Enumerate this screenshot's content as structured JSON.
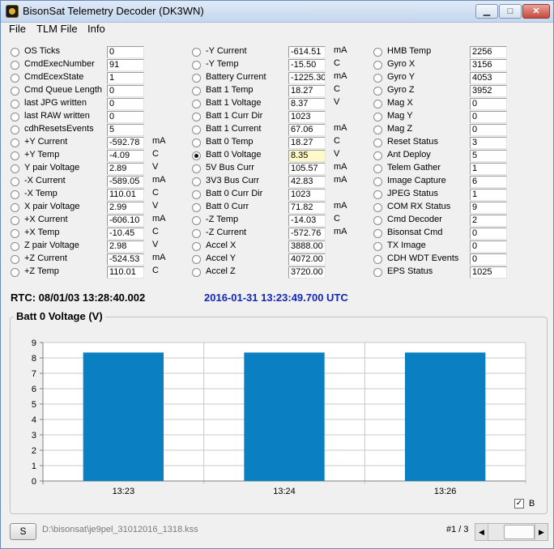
{
  "window": {
    "title": "BisonSat Telemetry Decoder (DK3WN)"
  },
  "menu": [
    "File",
    "TLM File",
    "Info"
  ],
  "columns": [
    [
      {
        "label": "OS Ticks",
        "value": "0",
        "unit": ""
      },
      {
        "label": "CmdExecNumber",
        "value": "91",
        "unit": ""
      },
      {
        "label": "CmdEcexState",
        "value": "1",
        "unit": ""
      },
      {
        "label": "Cmd Queue Length",
        "value": "0",
        "unit": ""
      },
      {
        "label": "last JPG written",
        "value": "0",
        "unit": ""
      },
      {
        "label": "last RAW written",
        "value": "0",
        "unit": ""
      },
      {
        "label": "cdhResetsEvents",
        "value": "5",
        "unit": ""
      },
      {
        "label": "+Y Current",
        "value": "-592.78",
        "unit": "mA"
      },
      {
        "label": "+Y Temp",
        "value": "-4.09",
        "unit": "C"
      },
      {
        "label": "Y pair Voltage",
        "value": "2.89",
        "unit": "V"
      },
      {
        "label": "-X Current",
        "value": "-589.05",
        "unit": "mA"
      },
      {
        "label": "-X Temp",
        "value": "110.01",
        "unit": "C"
      },
      {
        "label": "X pair Voltage",
        "value": "2.99",
        "unit": "V"
      },
      {
        "label": "+X Current",
        "value": "-606.10",
        "unit": "mA"
      },
      {
        "label": "+X Temp",
        "value": "-10.45",
        "unit": "C"
      },
      {
        "label": "Z pair Voltage",
        "value": "2.98",
        "unit": "V"
      },
      {
        "label": "+Z Current",
        "value": "-524.53",
        "unit": "mA"
      },
      {
        "label": "+Z Temp",
        "value": "110.01",
        "unit": "C"
      }
    ],
    [
      {
        "label": "-Y Current",
        "value": "-614.51",
        "unit": "mA"
      },
      {
        "label": "-Y Temp",
        "value": "-15.50",
        "unit": "C"
      },
      {
        "label": "Battery Current",
        "value": "-1225.30",
        "unit": "mA"
      },
      {
        "label": "Batt 1 Temp",
        "value": "18.27",
        "unit": "C"
      },
      {
        "label": "Batt 1 Voltage",
        "value": "8.37",
        "unit": "V"
      },
      {
        "label": "Batt 1 Curr Dir",
        "value": "1023",
        "unit": ""
      },
      {
        "label": "Batt 1 Current",
        "value": "67.06",
        "unit": "mA"
      },
      {
        "label": "Batt 0 Temp",
        "value": "18.27",
        "unit": "C"
      },
      {
        "label": "Batt 0 Voltage",
        "value": "8.35",
        "unit": "V",
        "selected": true
      },
      {
        "label": "5V Bus Curr",
        "value": "105.57",
        "unit": "mA"
      },
      {
        "label": "3V3 Bus Curr",
        "value": "42.83",
        "unit": "mA"
      },
      {
        "label": "Batt 0 Curr Dir",
        "value": "1023",
        "unit": ""
      },
      {
        "label": "Batt 0 Curr",
        "value": "71.82",
        "unit": "mA"
      },
      {
        "label": "-Z Temp",
        "value": "-14.03",
        "unit": "C"
      },
      {
        "label": "-Z Current",
        "value": "-572.76",
        "unit": "mA"
      },
      {
        "label": "Accel X",
        "value": "3888.00",
        "unit": ""
      },
      {
        "label": "Accel Y",
        "value": "4072.00",
        "unit": ""
      },
      {
        "label": "Accel Z",
        "value": "3720.00",
        "unit": ""
      }
    ],
    [
      {
        "label": "HMB Temp",
        "value": "2256",
        "unit": ""
      },
      {
        "label": "Gyro X",
        "value": "3156",
        "unit": ""
      },
      {
        "label": "Gyro Y",
        "value": "4053",
        "unit": ""
      },
      {
        "label": "Gyro Z",
        "value": "3952",
        "unit": ""
      },
      {
        "label": "Mag X",
        "value": "0",
        "unit": ""
      },
      {
        "label": "Mag Y",
        "value": "0",
        "unit": ""
      },
      {
        "label": "Mag Z",
        "value": "0",
        "unit": ""
      },
      {
        "label": "Reset Status",
        "value": "3",
        "unit": ""
      },
      {
        "label": "Ant Deploy",
        "value": "5",
        "unit": ""
      },
      {
        "label": "Telem Gather",
        "value": "1",
        "unit": ""
      },
      {
        "label": "Image Capture",
        "value": "6",
        "unit": ""
      },
      {
        "label": "JPEG Status",
        "value": "1",
        "unit": ""
      },
      {
        "label": "COM RX Status",
        "value": "9",
        "unit": ""
      },
      {
        "label": "Cmd Decoder",
        "value": "2",
        "unit": ""
      },
      {
        "label": "Bisonsat Cmd",
        "value": "0",
        "unit": ""
      },
      {
        "label": "TX Image",
        "value": "0",
        "unit": ""
      },
      {
        "label": "CDH WDT Events",
        "value": "0",
        "unit": ""
      },
      {
        "label": "EPS Status",
        "value": "1025",
        "unit": ""
      }
    ]
  ],
  "rtc": "RTC: 08/01/03 13:28:40.002",
  "utc": "2016-01-31 13:23:49.700 UTC",
  "chart_data": {
    "type": "bar",
    "title": "Batt 0 Voltage (V)",
    "categories": [
      "13:23",
      "13:24",
      "13:26"
    ],
    "values": [
      8.35,
      8.35,
      8.35
    ],
    "ylim": [
      0,
      9
    ],
    "yticks": [
      "0",
      "1",
      "2",
      "3",
      "4",
      "5",
      "6",
      "7",
      "8",
      "9"
    ],
    "series_color": "#0a7fc1",
    "grid": true,
    "legend": {
      "label": "B",
      "checked": true,
      "position": "bottom-right"
    }
  },
  "footer": {
    "button": "S",
    "file_path": "D:\\bisonsat\\je9pel_31012016_1318.kss",
    "page": "#1 / 3"
  }
}
